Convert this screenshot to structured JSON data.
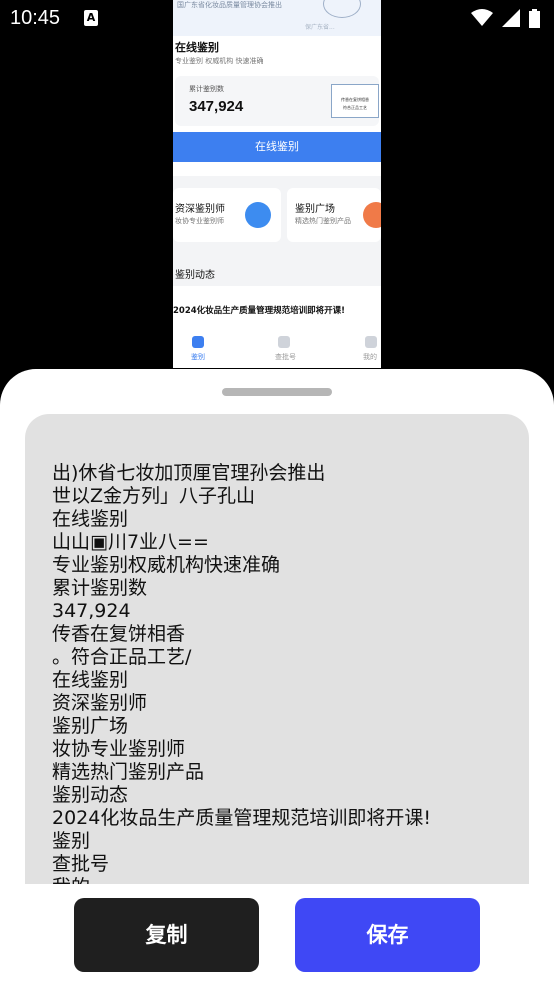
{
  "status_bar": {
    "time": "10:45",
    "notification_icon": "A"
  },
  "preview": {
    "banner_text": "国广东省化妆品质量管理协会推出",
    "banner_text2": "保广东省...",
    "section_title": "在线鉴别",
    "tags": "专业鉴别  权威机构  快速准确",
    "counter_label": "累计鉴别数",
    "counter_value": "347,924",
    "cert_line1": "传香在复饼相香",
    "cert_line2": "符合正品工艺",
    "primary_button": "在线鉴别",
    "card1_title": "资深鉴别师",
    "card1_sub": "妆协专业鉴别师",
    "card2_title": "鉴别广场",
    "card2_sub": "精选热门鉴别产品",
    "news_heading": "鉴别动态",
    "news_item": "2024化妆品生产质量管理规范培训即将开课!",
    "tabs": [
      "鉴别",
      "查批号",
      "我的"
    ]
  },
  "ocr_lines": [
    "出)休省七妆加顶厘官理孙会推出",
    "世以Z金方列」八子孔山",
    "在线鉴别",
    "山山▣川7业八==",
    "专业鉴别权威机构快速准确",
    "累计鉴别数",
    "347,924",
    "传香在复饼相香",
    "。符合正品工艺/",
    "在线鉴别",
    "资深鉴别师",
    "鉴别广场",
    "妆协专业鉴别师",
    "精选热门鉴别产品",
    "鉴别动态",
    "2024化妆品生产质量管理规范培训即将开课!",
    "鉴别",
    "查批号",
    "我的"
  ],
  "actions": {
    "copy_label": "复制",
    "save_label": "保存"
  },
  "colors": {
    "save_button": "#3f48f5",
    "copy_button": "#1f1f1f",
    "preview_accent": "#3d7ff0"
  }
}
